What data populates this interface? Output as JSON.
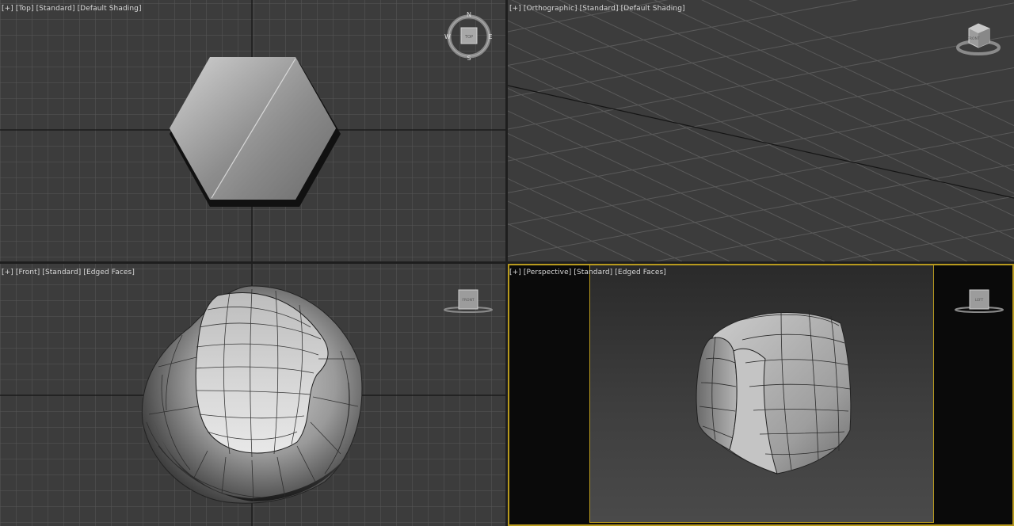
{
  "viewports": {
    "top": {
      "label_menu": "[+]",
      "label_view": "[Top]",
      "label_shading": "[Standard]",
      "label_mode": "[Default Shading]"
    },
    "orthographic": {
      "label_menu": "[+]",
      "label_view": "[Orthographic]",
      "label_shading": "[Standard]",
      "label_mode": "[Default Shading]"
    },
    "front": {
      "label_menu": "[+]",
      "label_view": "[Front]",
      "label_shading": "[Standard]",
      "label_mode": "[Edged Faces]"
    },
    "perspective": {
      "label_menu": "[+]",
      "label_view": "[Perspective]",
      "label_shading": "[Standard]",
      "label_mode": "[Edged Faces]"
    }
  },
  "compass": {
    "north": "N",
    "south": "S",
    "east": "E",
    "west": "W",
    "cube_face": "TOP"
  },
  "viewcube": {
    "ortho_face": "FRONT",
    "front_face": "FRONT",
    "persp_face": "LEFT"
  },
  "colors": {
    "viewport_bg": "#3c3c3c",
    "grid_line": "#5a5a5a",
    "grid_axis": "#141414",
    "active_border": "#b89a1e",
    "object_gray": "#9a9a9a"
  }
}
